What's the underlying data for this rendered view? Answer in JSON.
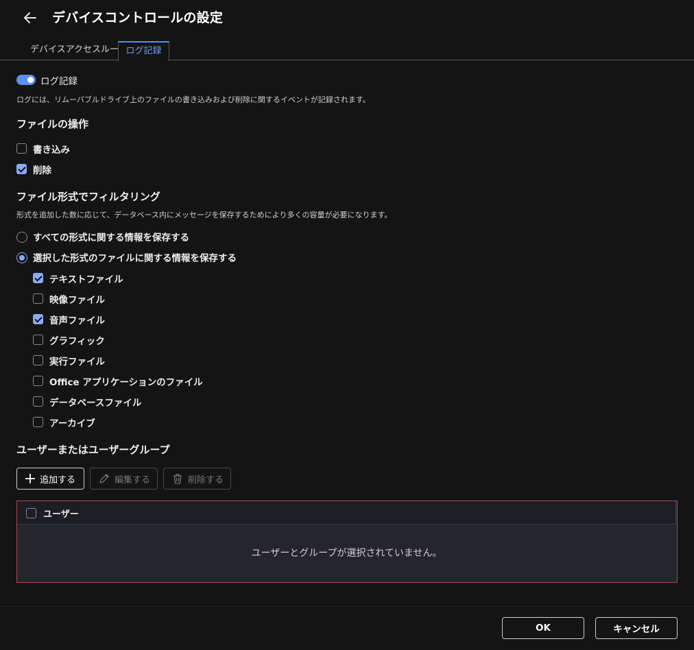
{
  "header": {
    "title": "デバイスコントロールの設定"
  },
  "tabs": [
    {
      "label": "デバイスアクセスルール"
    },
    {
      "label": "ログ記録"
    }
  ],
  "logging": {
    "toggle_label": "ログ記録",
    "enabled": true,
    "description": "ログには、リムーバブルドライブ上のファイルの書き込みおよび削除に関するイベントが記録されます。"
  },
  "file_operations": {
    "title": "ファイルの操作",
    "items": [
      {
        "label": "書き込み",
        "checked": false
      },
      {
        "label": "削除",
        "checked": true
      }
    ]
  },
  "filter": {
    "title": "ファイル形式でフィルタリング",
    "description": "形式を追加した数に応じて、データベース内にメッセージを保存するためにより多くの容量が必要になります。",
    "options": [
      {
        "label": "すべての形式に関する情報を保存する",
        "selected": false
      },
      {
        "label": "選択した形式のファイルに関する情報を保存する",
        "selected": true
      }
    ],
    "types": [
      {
        "label": "テキストファイル",
        "checked": true
      },
      {
        "label": "映像ファイル",
        "checked": false
      },
      {
        "label": "音声ファイル",
        "checked": true
      },
      {
        "label": "グラフィック",
        "checked": false
      },
      {
        "label": "実行ファイル",
        "checked": false
      },
      {
        "label": "Office アプリケーションのファイル",
        "checked": false
      },
      {
        "label": "データベースファイル",
        "checked": false
      },
      {
        "label": "アーカイブ",
        "checked": false
      }
    ]
  },
  "users": {
    "title": "ユーザーまたはユーザーグループ",
    "add_label": "追加する",
    "edit_label": "編集する",
    "delete_label": "削除する",
    "column_user": "ユーザー",
    "empty_text": "ユーザーとグループが選択されていません。"
  },
  "footer": {
    "ok_label": "OK",
    "cancel_label": "キャンセル"
  },
  "colors": {
    "accent": "#5b8af2",
    "check_fill": "#8aaaf5",
    "error_border": "#b0444c"
  }
}
